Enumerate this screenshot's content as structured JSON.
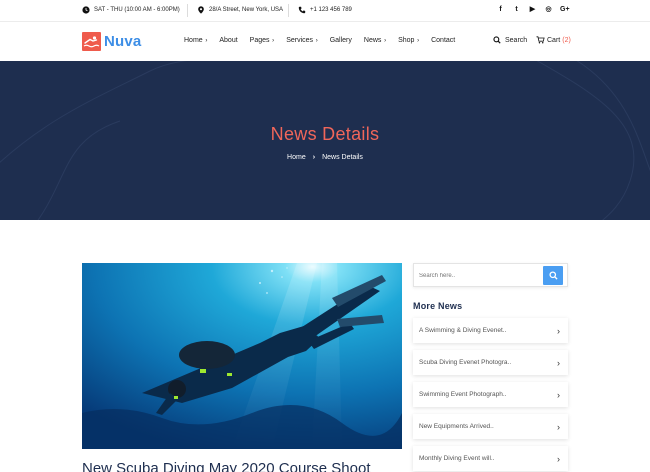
{
  "topbar": {
    "hours": "SAT - THU (10:00 AM - 6:00PM)",
    "address": "28/A Street, New York, USA",
    "phone": "+1 123 456 789",
    "socials": [
      "f",
      "t",
      "▶",
      "◎",
      "G+"
    ]
  },
  "header": {
    "logo_text": "Nuva",
    "nav": [
      {
        "label": "Home",
        "has_dropdown": true
      },
      {
        "label": "About",
        "has_dropdown": false
      },
      {
        "label": "Pages",
        "has_dropdown": true
      },
      {
        "label": "Services",
        "has_dropdown": true
      },
      {
        "label": "Gallery",
        "has_dropdown": false
      },
      {
        "label": "News",
        "has_dropdown": true
      },
      {
        "label": "Shop",
        "has_dropdown": true
      },
      {
        "label": "Contact",
        "has_dropdown": false
      }
    ],
    "search_label": "Search",
    "cart_label": "Cart",
    "cart_count": "(2)"
  },
  "hero": {
    "title": "News Details",
    "breadcrumb_home": "Home",
    "breadcrumb_current": "News Details"
  },
  "article": {
    "title": "New Scuba Diving May 2020 Course Shoot"
  },
  "sidebar": {
    "search_placeholder": "Search here..",
    "more_news_title": "More News",
    "news": [
      "A Swimming & Diving Evenet..",
      "Scuba Diving Evenet Photogra..",
      "Swimming Event Photograph..",
      "New Equipments Arrived..",
      "Monthly Diving Event will.."
    ]
  },
  "colors": {
    "accent": "#ef5b4c",
    "brand_blue": "#3d8ee6",
    "hero_bg": "#1e2e4f",
    "search_button": "#4a9ef2"
  }
}
